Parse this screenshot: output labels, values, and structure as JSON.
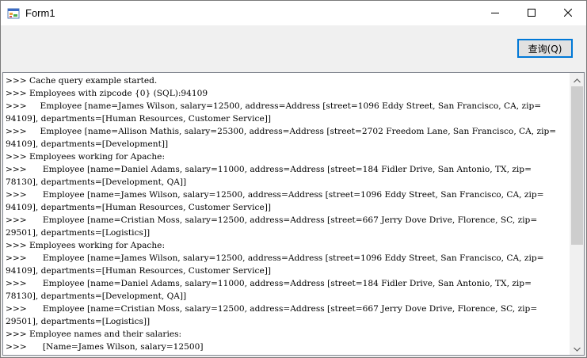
{
  "window": {
    "title": "Form1",
    "icon": "windows-form-icon",
    "controls": [
      "minimize-icon",
      "maximize-icon",
      "close-icon"
    ]
  },
  "toolbar": {
    "query_label": "查询(Q)"
  },
  "output": {
    "lines": [
      ">>> Cache query example started.",
      ">>> Employees with zipcode {0} (SQL):94109",
      ">>>     Employee [name=James Wilson, salary=12500, address=Address [street=1096 Eddy Street, San Francisco, CA, zip=",
      "94109], departments=[Human Resources, Customer Service]]",
      ">>>     Employee [name=Allison Mathis, salary=25300, address=Address [street=2702 Freedom Lane, San Francisco, CA, zip=",
      "94109], departments=[Development]]",
      ">>> Employees working for Apache:",
      ">>>      Employee [name=Daniel Adams, salary=11000, address=Address [street=184 Fidler Drive, San Antonio, TX, zip=",
      "78130], departments=[Development, QA]]",
      ">>>      Employee [name=James Wilson, salary=12500, address=Address [street=1096 Eddy Street, San Francisco, CA, zip=",
      "94109], departments=[Human Resources, Customer Service]]",
      ">>>      Employee [name=Cristian Moss, salary=12500, address=Address [street=667 Jerry Dove Drive, Florence, SC, zip=",
      "29501], departments=[Logistics]]",
      ">>> Employees working for Apache:",
      ">>>      Employee [name=James Wilson, salary=12500, address=Address [street=1096 Eddy Street, San Francisco, CA, zip=",
      "94109], departments=[Human Resources, Customer Service]]",
      ">>>      Employee [name=Daniel Adams, salary=11000, address=Address [street=184 Fidler Drive, San Antonio, TX, zip=",
      "78130], departments=[Development, QA]]",
      ">>>      Employee [name=Cristian Moss, salary=12500, address=Address [street=667 Jerry Dove Drive, Florence, SC, zip=",
      "29501], departments=[Logistics]]",
      ">>> Employee names and their salaries:",
      ">>>      [Name=James Wilson, salary=12500]"
    ]
  }
}
